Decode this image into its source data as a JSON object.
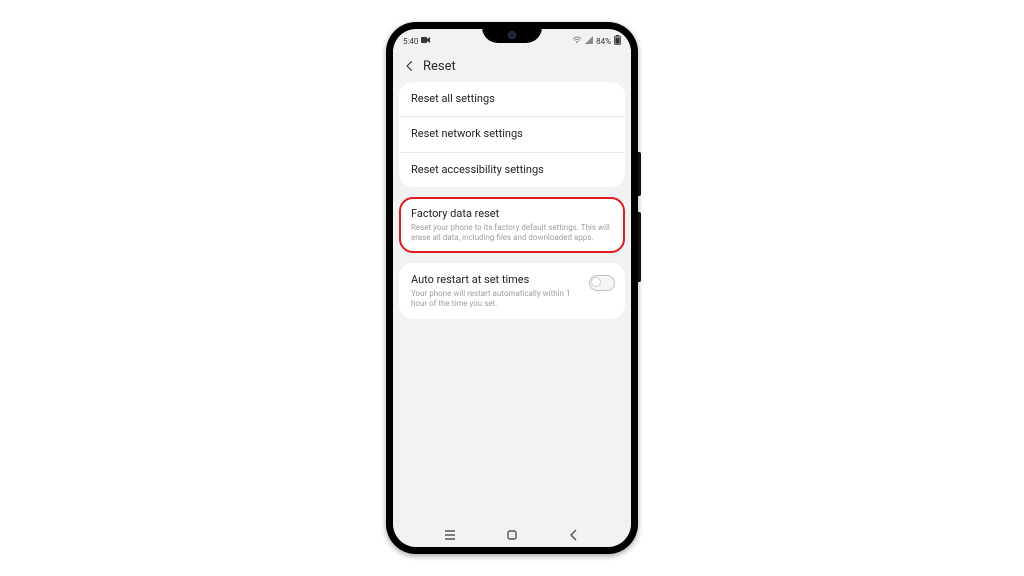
{
  "statusbar": {
    "time": "5:40",
    "battery_pct": "84%"
  },
  "appbar": {
    "title": "Reset"
  },
  "groups": {
    "g1": {
      "items": [
        {
          "title": "Reset all settings"
        },
        {
          "title": "Reset network settings"
        },
        {
          "title": "Reset accessibility settings"
        }
      ]
    },
    "g2": {
      "items": [
        {
          "title": "Factory data reset",
          "sub": "Reset your phone to its factory default settings. This will erase all data, including files and downloaded apps."
        }
      ]
    },
    "g3": {
      "items": [
        {
          "title": "Auto restart at set times",
          "sub": "Your phone will restart automatically within 1 hour of the time you set.",
          "toggle": false
        }
      ]
    }
  },
  "highlight_color": "#e11b1b"
}
